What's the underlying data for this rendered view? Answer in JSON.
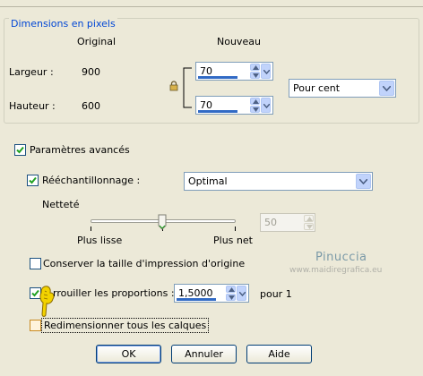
{
  "group": {
    "title": "Dimensions en pixels",
    "col_original": "Original",
    "col_new": "Nouveau",
    "width_label": "Largeur :",
    "width_original": "900",
    "width_new": "70",
    "height_label": "Hauteur :",
    "height_original": "600",
    "height_new": "70",
    "unit_selected": "Pour cent"
  },
  "advanced": {
    "label": "Paramètres avancés",
    "checked": true
  },
  "resample": {
    "label": "Rééchantillonnage :",
    "checked": true,
    "method_selected": "Optimal"
  },
  "sharpness": {
    "label": "Netteté",
    "left_label": "Plus lisse",
    "right_label": "Plus net",
    "value": "50",
    "level": 0.5
  },
  "keep_print_size": {
    "label": "Conserver la taille d'impression d'origine",
    "checked": false
  },
  "lock_ratio": {
    "label": "rrouiller les proportions :",
    "checked": true,
    "value": "1,5000",
    "suffix": "pour 1"
  },
  "resize_all_layers": {
    "label": "Redimensionner tous les calques",
    "checked": false
  },
  "buttons": {
    "ok": "OK",
    "cancel": "Annuler",
    "help": "Aide"
  },
  "watermark": {
    "name": "Pinuccia",
    "site": "www.maidiregrafica.eu"
  },
  "colors": {
    "accent": "#316ac5",
    "group_title": "#0046d5",
    "background": "#ece9d8"
  }
}
